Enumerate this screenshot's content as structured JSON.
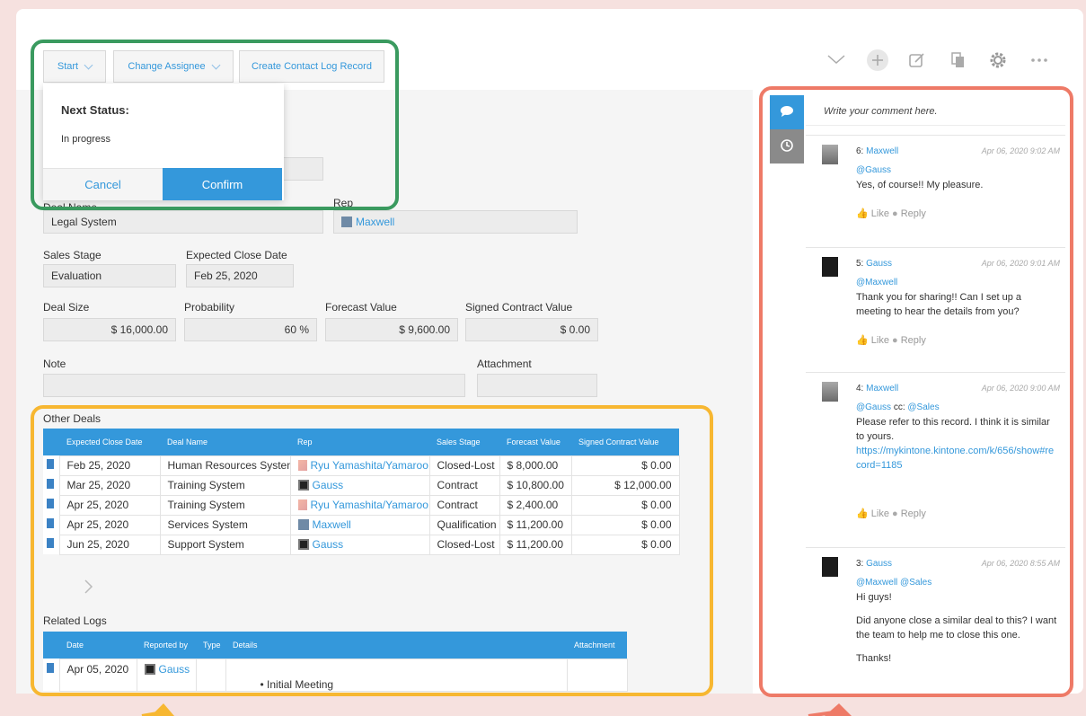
{
  "toolbar": {
    "start_label": "Start",
    "change_assignee_label": "Change Assignee",
    "create_log_label": "Create Contact Log Record"
  },
  "status_popup": {
    "title": "Next Status:",
    "status": "In progress",
    "cancel_label": "Cancel",
    "confirm_label": "Confirm"
  },
  "form": {
    "deal_name_value": "Legal System",
    "rep_label": "Rep",
    "rep_value": "Maxwell",
    "sales_stage_label": "Sales Stage",
    "sales_stage_value": "Evaluation",
    "expected_close_label": "Expected Close Date",
    "expected_close_value": "Feb 25, 2020",
    "deal_size_label": "Deal Size",
    "deal_size_value": "$ 16,000.00",
    "probability_label": "Probability",
    "probability_value": "60 %",
    "forecast_label": "Forecast Value",
    "forecast_value": "$ 9,600.00",
    "signed_label": "Signed Contract Value",
    "signed_value": "$ 0.00",
    "note_label": "Note",
    "attachment_label": "Attachment"
  },
  "other_deals": {
    "label": "Other Deals",
    "headers": [
      "Expected Close Date",
      "Deal Name",
      "Rep",
      "Sales Stage",
      "Forecast Value",
      "Signed Contract Value"
    ],
    "rows": [
      {
        "date": "Feb 25, 2020",
        "name": "Human Resources System",
        "rep": "Ryu Yamashita/Yamaroo",
        "stage": "Closed-Lost",
        "forecast": "$ 8,000.00",
        "signed": "$ 0.00"
      },
      {
        "date": "Mar 25, 2020",
        "name": "Training System",
        "rep": "Gauss",
        "stage": "Contract",
        "forecast": "$ 10,800.00",
        "signed": "$ 12,000.00"
      },
      {
        "date": "Apr 25, 2020",
        "name": "Training System",
        "rep": "Ryu Yamashita/Yamaroo",
        "stage": "Contract",
        "forecast": "$ 2,400.00",
        "signed": "$ 0.00"
      },
      {
        "date": "Apr 25, 2020",
        "name": "Services System",
        "rep": "Maxwell",
        "stage": "Qualification",
        "forecast": "$ 11,200.00",
        "signed": "$ 0.00"
      },
      {
        "date": "Jun 25, 2020",
        "name": "Support System",
        "rep": "Gauss",
        "stage": "Closed-Lost",
        "forecast": "$ 11,200.00",
        "signed": "$ 0.00"
      }
    ]
  },
  "related_logs": {
    "label": "Related Logs",
    "headers": [
      "Date",
      "Reported by",
      "Type",
      "Details",
      "Attachment"
    ],
    "rows": [
      {
        "date": "Apr 05, 2020",
        "reporter": "Gauss",
        "type": "",
        "details": "Initial Meeting"
      }
    ]
  },
  "comments_panel": {
    "input_placeholder": "Write your comment here.",
    "like_label": "Like",
    "reply_label": "Reply",
    "comments": [
      {
        "number": "6:",
        "author": "Maxwell",
        "date": "Apr 06, 2020 9:02 AM",
        "mention": "@Gauss",
        "text": "Yes, of course!! My pleasure."
      },
      {
        "number": "5:",
        "author": "Gauss",
        "date": "Apr 06, 2020 9:01 AM",
        "mention": "@Maxwell",
        "text": "Thank you for sharing!! Can I set up a meeting to hear the details from you?"
      },
      {
        "number": "4:",
        "author": "Maxwell",
        "date": "Apr 06, 2020 9:00 AM",
        "mention": "@Gauss",
        "cc": "cc:",
        "mention2": "@Sales",
        "text": "Please refer to this record. I think it is similar to yours.",
        "link": "https://mykintone.kintone.com/k/656/show#record=1185"
      },
      {
        "number": "3:",
        "author": "Gauss",
        "date": "Apr 06, 2020 8:55 AM",
        "mention": "@Maxwell @Sales",
        "text": "Hi guys!",
        "text2": "Did anyone close a similar deal to this? I want the team to help me to close this one.",
        "text3": "Thanks!"
      }
    ]
  },
  "icons": [
    "chevron-down-icon",
    "plus-icon",
    "edit-icon",
    "duplicate-icon",
    "gear-icon",
    "more-icon",
    "comment-icon",
    "history-icon",
    "document-icon"
  ],
  "colors": {
    "background": "#f6e1df",
    "accent": "#3498db",
    "highlight_green": "#3a9a5f",
    "highlight_yellow": "#f7b731",
    "highlight_red": "#ee7a67"
  }
}
